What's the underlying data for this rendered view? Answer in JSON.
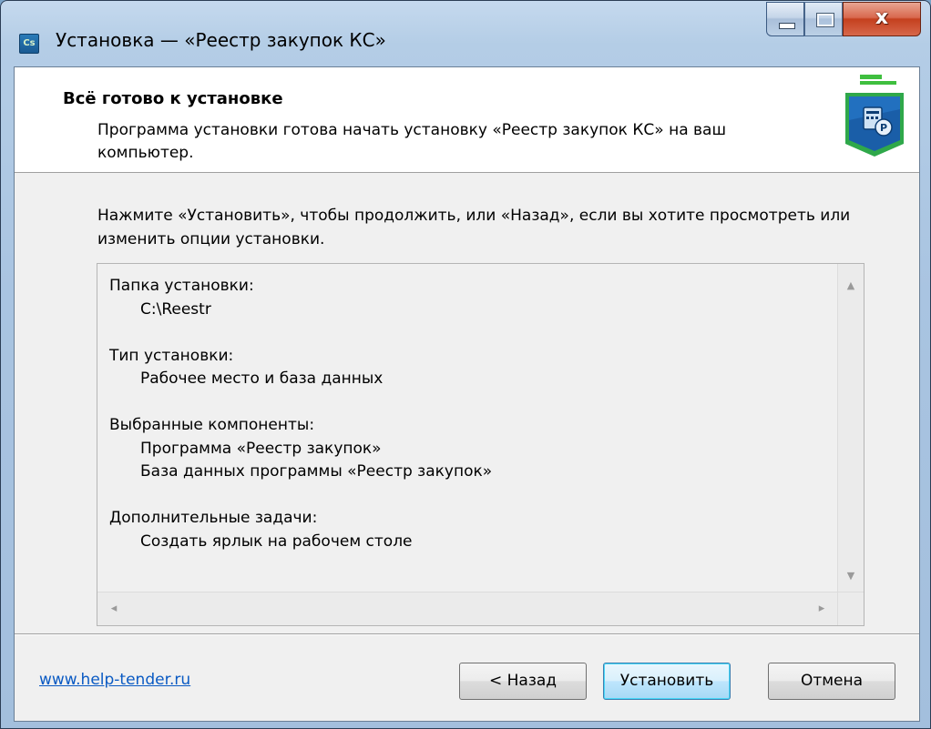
{
  "window": {
    "title": "Установка — «Реестр закупок КС»",
    "icon_text": "Cs"
  },
  "header": {
    "title": "Всё готово к установке",
    "subtitle": "Программа установки готова начать установку «Реестр закупок КС» на ваш компьютер."
  },
  "main": {
    "intro": "Нажмите «Установить», чтобы продолжить, или «Назад», если вы хотите просмотреть или изменить опции установки.",
    "summary": [
      {
        "heading": "Папка установки:",
        "items": [
          "C:\\Reestr"
        ]
      },
      {
        "heading": "Тип установки:",
        "items": [
          "Рабочее место и база данных"
        ]
      },
      {
        "heading": "Выбранные компоненты:",
        "items": [
          "Программа «Реестр закупок»",
          "База данных программы «Реестр закупок»"
        ]
      },
      {
        "heading": "Дополнительные задачи:",
        "items": [
          "Создать ярлык на рабочем столе"
        ]
      }
    ]
  },
  "footer": {
    "link": "www.help-tender.ru",
    "back_label": "< Назад",
    "install_label": "Установить",
    "cancel_label": "Отмена"
  },
  "colors": {
    "link": "#0a5ac3",
    "close_button": "#c4401e",
    "default_button_border": "#3c7fb1"
  }
}
